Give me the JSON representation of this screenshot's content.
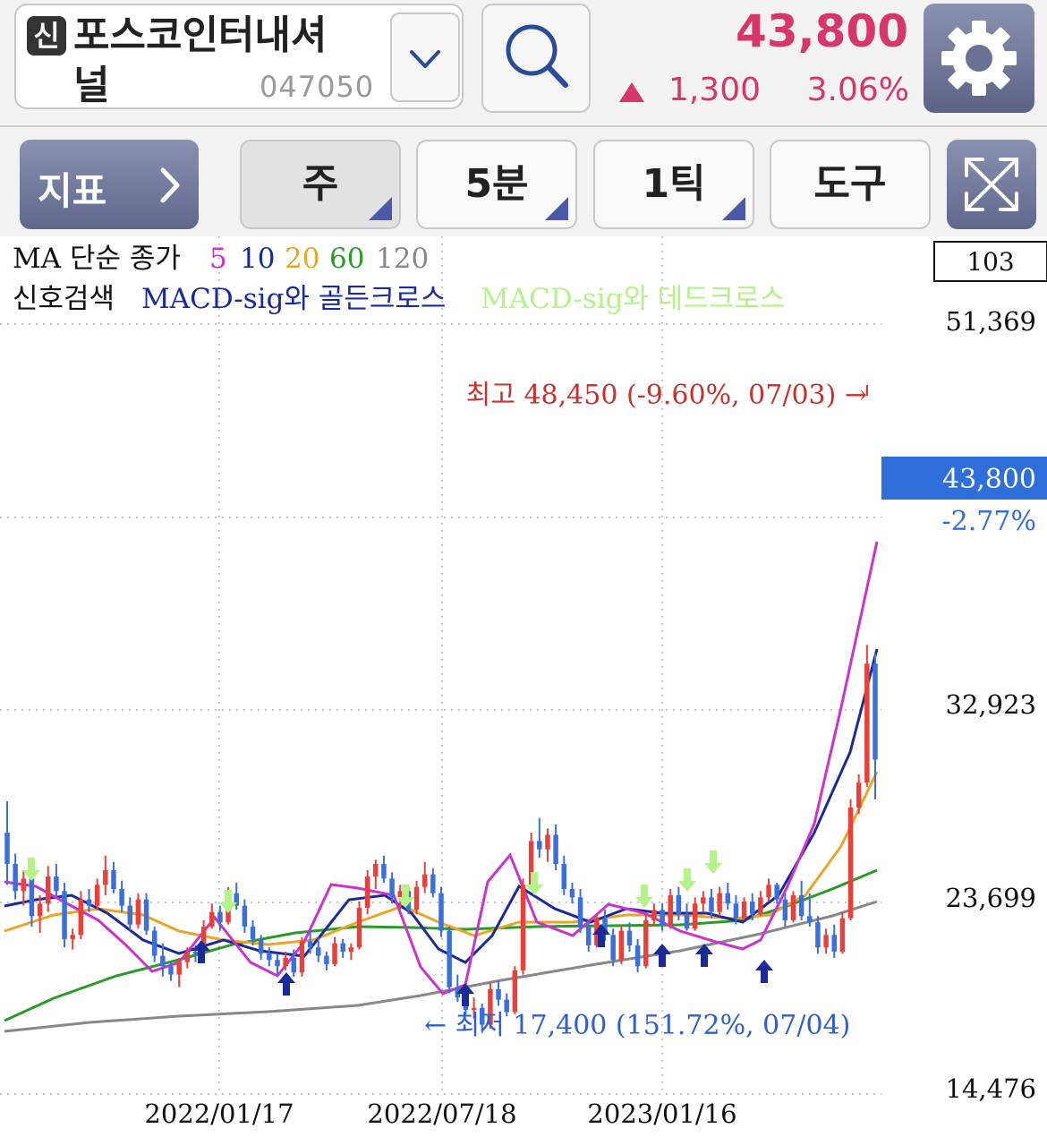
{
  "header": {
    "badge": "신",
    "stock_name_line1": "포스코인터내셔",
    "stock_name_line2": "널",
    "stock_code": "047050",
    "price": "43,800",
    "change": "1,300",
    "change_rate": "3.06%",
    "up_color": "#d7366b",
    "icons": [
      "chevron-down-icon",
      "search-icon",
      "gear-icon"
    ]
  },
  "toolbar": {
    "indicator_label": "지표",
    "period_label": "주",
    "minute_label": "5분",
    "tick_label": "1틱",
    "tools_label": "도구",
    "icons": [
      "chevron-right-icon",
      "expand-icon"
    ]
  },
  "legend": {
    "ma_prefix": "MA 단순 종가",
    "ma_periods": [
      {
        "label": "5",
        "color": "#cc33cc"
      },
      {
        "label": "10",
        "color": "#1a2a99"
      },
      {
        "label": "20",
        "color": "#e8a628"
      },
      {
        "label": "60",
        "color": "#2a9a2a"
      },
      {
        "label": "120",
        "color": "#888888"
      }
    ],
    "signal_prefix": "신호검색",
    "golden_cross": "MACD-sig와 골든크로스",
    "dead_cross": "MACD-sig와 데드크로스",
    "golden_color": "#1a2a99",
    "dead_color": "#b5f28a"
  },
  "chart_data": {
    "type": "candlestick",
    "period": "weekly",
    "count_box": "103",
    "y_ticks": [
      "51,369",
      "32,923",
      "23,699",
      "14,476"
    ],
    "y_tick_values": [
      51369,
      32923,
      23699,
      14476
    ],
    "x_ticks": [
      "2022/01/17",
      "2022/07/18",
      "2023/01/16"
    ],
    "current_price_label": "43,800",
    "current_pct_label": "-2.77%",
    "high_annotation": "최고 48,450 (-9.60%, 07/03) →",
    "low_annotation": "← 최저 17,400 (151.72%, 07/04)",
    "high_value": 48450,
    "low_value": 17400,
    "current_value": 43800,
    "colors": {
      "up": "#e8413c",
      "down": "#3b6fd9",
      "price_box": "#2e6fdc",
      "high_text": "#c8322e",
      "low_text": "#2e5fd0"
    },
    "candles": [
      [
        27000,
        28500,
        24500,
        25500
      ],
      [
        25500,
        26000,
        23800,
        24200
      ],
      [
        24200,
        25200,
        23500,
        24800
      ],
      [
        24800,
        25000,
        22500,
        23000
      ],
      [
        23000,
        24000,
        22200,
        23600
      ],
      [
        23600,
        25400,
        23200,
        24900
      ],
      [
        24900,
        25500,
        23900,
        24200
      ],
      [
        24200,
        24600,
        21500,
        21900
      ],
      [
        21900,
        22400,
        21400,
        22100
      ],
      [
        22100,
        24200,
        21900,
        23800
      ],
      [
        23800,
        24300,
        23200,
        23500
      ],
      [
        23500,
        24800,
        23300,
        24500
      ],
      [
        24500,
        25900,
        24000,
        25200
      ],
      [
        25200,
        25600,
        24100,
        24300
      ],
      [
        24300,
        24700,
        23200,
        23500
      ],
      [
        23500,
        23900,
        22300,
        22600
      ],
      [
        22600,
        24100,
        22400,
        23800
      ],
      [
        23800,
        24100,
        22100,
        22300
      ],
      [
        22300,
        22500,
        20800,
        21100
      ],
      [
        21100,
        21700,
        20100,
        20600
      ],
      [
        20600,
        20800,
        19900,
        20200
      ],
      [
        20200,
        21000,
        19600,
        20800
      ],
      [
        20800,
        21500,
        20500,
        21300
      ],
      [
        21300,
        21600,
        20800,
        21200
      ],
      [
        21200,
        22800,
        21000,
        22500
      ],
      [
        22500,
        23600,
        22400,
        23200
      ],
      [
        23200,
        23500,
        22300,
        22700
      ],
      [
        22700,
        24400,
        22600,
        24100
      ],
      [
        24100,
        24600,
        23300,
        23500
      ],
      [
        23500,
        23800,
        22200,
        22500
      ],
      [
        22500,
        22800,
        21600,
        21900
      ],
      [
        21900,
        22100,
        20900,
        21200
      ],
      [
        21200,
        21500,
        20600,
        20900
      ],
      [
        20900,
        21200,
        20200,
        20600
      ],
      [
        20600,
        21300,
        20400,
        21000
      ],
      [
        21000,
        21400,
        20100,
        20300
      ],
      [
        20300,
        22000,
        20100,
        21800
      ],
      [
        21800,
        22300,
        21200,
        21500
      ],
      [
        21500,
        22000,
        20800,
        21100
      ],
      [
        21100,
        21300,
        20400,
        20700
      ],
      [
        20700,
        22000,
        20600,
        21700
      ],
      [
        21700,
        21900,
        21000,
        21300
      ],
      [
        21300,
        21700,
        20900,
        21500
      ],
      [
        21500,
        23700,
        21400,
        23400
      ],
      [
        23400,
        25200,
        23100,
        24900
      ],
      [
        24900,
        25700,
        24300,
        25500
      ],
      [
        25500,
        25900,
        24600,
        24800
      ],
      [
        24800,
        25100,
        23600,
        23900
      ],
      [
        23900,
        24500,
        23300,
        24200
      ],
      [
        24200,
        24400,
        23100,
        23300
      ],
      [
        23300,
        24700,
        23100,
        24400
      ],
      [
        24400,
        25600,
        24100,
        25000
      ],
      [
        25000,
        25300,
        23900,
        24100
      ],
      [
        24100,
        24400,
        22000,
        22300
      ],
      [
        22300,
        22500,
        19300,
        19600
      ],
      [
        19600,
        20200,
        18900,
        19100
      ],
      [
        19100,
        19400,
        18300,
        18500
      ],
      [
        18500,
        19100,
        18100,
        18600
      ],
      [
        18600,
        18800,
        17400,
        17800
      ],
      [
        17800,
        19800,
        17600,
        19500
      ],
      [
        19500,
        19900,
        18700,
        19000
      ],
      [
        19000,
        19300,
        18200,
        18400
      ],
      [
        18400,
        20600,
        18300,
        20400
      ],
      [
        20400,
        24800,
        20200,
        24500
      ],
      [
        24500,
        27000,
        24300,
        26600
      ],
      [
        26600,
        27700,
        25800,
        26200
      ],
      [
        26200,
        27200,
        25600,
        26900
      ],
      [
        26900,
        27400,
        25200,
        25500
      ],
      [
        25500,
        25900,
        24000,
        24300
      ],
      [
        24300,
        24600,
        23600,
        23900
      ],
      [
        23900,
        24300,
        22200,
        22500
      ],
      [
        22500,
        22800,
        21300,
        21600
      ],
      [
        21600,
        23100,
        21500,
        22900
      ],
      [
        22900,
        23300,
        21800,
        22100
      ],
      [
        22100,
        22400,
        20600,
        20900
      ],
      [
        20900,
        22600,
        20700,
        22300
      ],
      [
        22300,
        22700,
        21300,
        21600
      ],
      [
        21600,
        21900,
        20300,
        20600
      ],
      [
        20600,
        23100,
        20500,
        22800
      ],
      [
        22800,
        23600,
        22500,
        23300
      ],
      [
        23300,
        23600,
        22300,
        22600
      ],
      [
        22600,
        24300,
        22400,
        24000
      ],
      [
        24000,
        24400,
        22800,
        23100
      ],
      [
        23100,
        23600,
        22300,
        22400
      ],
      [
        22400,
        23900,
        22300,
        23600
      ],
      [
        23600,
        24200,
        23200,
        23900
      ],
      [
        23900,
        24300,
        22900,
        23200
      ],
      [
        23200,
        24400,
        23000,
        24100
      ],
      [
        24100,
        24600,
        23300,
        23600
      ],
      [
        23600,
        24000,
        22600,
        22900
      ],
      [
        22900,
        23900,
        22800,
        23700
      ],
      [
        23700,
        24100,
        22800,
        23100
      ],
      [
        23100,
        24200,
        23000,
        23900
      ],
      [
        23900,
        24800,
        23700,
        24500
      ],
      [
        24500,
        24600,
        23600,
        23800
      ],
      [
        23800,
        24100,
        22500,
        22800
      ],
      [
        22800,
        24200,
        22700,
        24000
      ],
      [
        24000,
        24700,
        22800,
        23000
      ],
      [
        23000,
        24100,
        22500,
        22700
      ],
      [
        22700,
        23000,
        21200,
        21500
      ],
      [
        21500,
        22400,
        21200,
        22100
      ],
      [
        22100,
        22600,
        21000,
        21300
      ],
      [
        21300,
        23200,
        21200,
        22900
      ],
      [
        22900,
        28600,
        22800,
        28200
      ],
      [
        28200,
        29800,
        27900,
        29400
      ],
      [
        29400,
        36000,
        29200,
        35100
      ],
      [
        35100,
        35600,
        28600,
        30500
      ]
    ]
  }
}
